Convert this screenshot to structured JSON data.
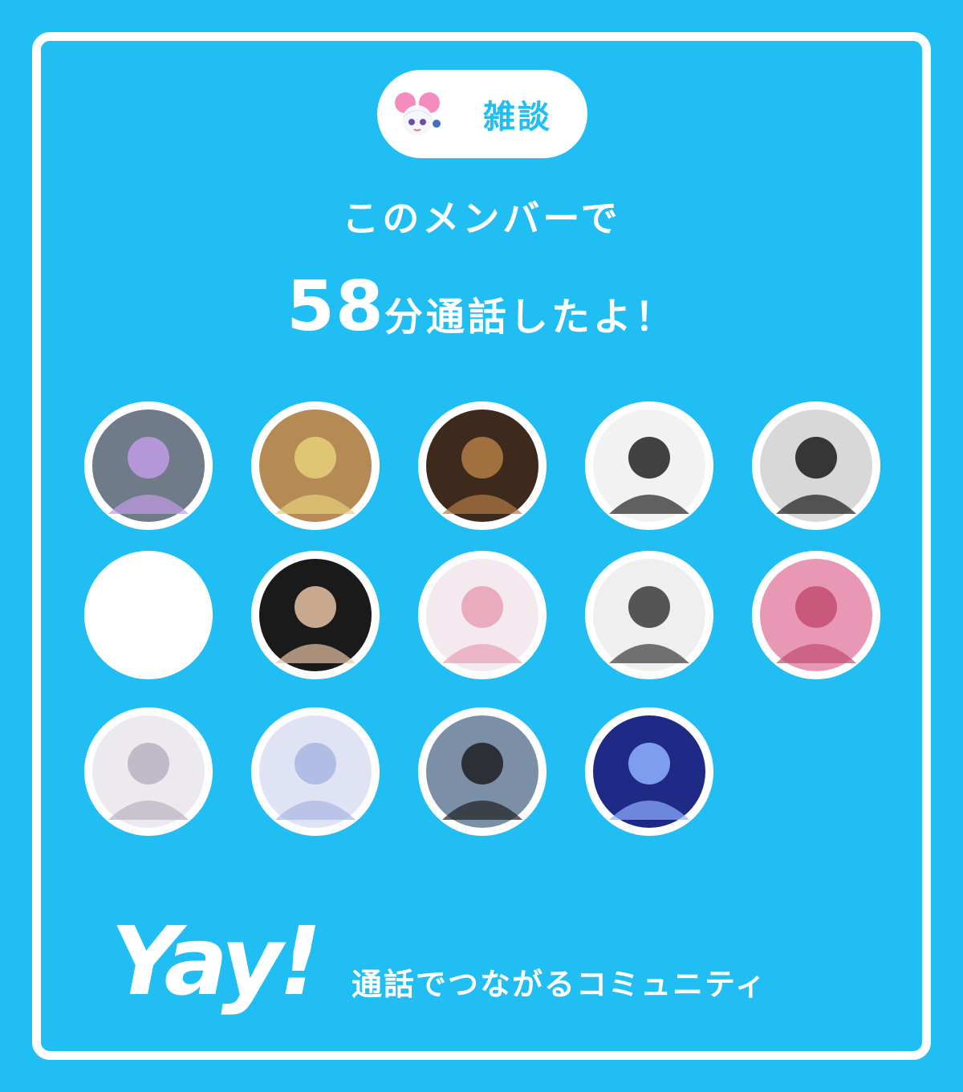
{
  "chip": {
    "label": "雑談",
    "icon": "mascot-icon"
  },
  "headline": {
    "line1": "このメンバーで",
    "minutes": "58",
    "suffix": "分通話したよ！"
  },
  "members": [
    {
      "icon": "rock-character-avatar",
      "tone": "#6f7b88",
      "accent": "#c29be6"
    },
    {
      "icon": "doorway-figures-avatar",
      "tone": "#b68a54",
      "accent": "#e6d07a"
    },
    {
      "icon": "dog-avatar",
      "tone": "#3e2a1c",
      "accent": "#b47b44"
    },
    {
      "icon": "manga-swordsman-avatar",
      "tone": "#f2f2f2",
      "accent": "#222222"
    },
    {
      "icon": "manga-girl-bw-avatar",
      "tone": "#d8d8d8",
      "accent": "#1a1a1a"
    },
    {
      "icon": "blank-avatar",
      "tone": "#ffffff",
      "accent": "#ffffff"
    },
    {
      "icon": "dark-hair-boy-avatar",
      "tone": "#1a1a1a",
      "accent": "#e8c3a4"
    },
    {
      "icon": "pink-hair-girl-avatar",
      "tone": "#f3e9ee",
      "accent": "#e7a0b5"
    },
    {
      "icon": "manga-boy-sketch-avatar",
      "tone": "#efefef",
      "accent": "#3a3a3a"
    },
    {
      "icon": "pink-tint-girl-avatar",
      "tone": "#e898b4",
      "accent": "#c24d73"
    },
    {
      "icon": "white-hair-anime-avatar",
      "tone": "#ece9ef",
      "accent": "#b9b3c2"
    },
    {
      "icon": "pastel-anime-girl-avatar",
      "tone": "#dfe3f4",
      "accent": "#a8b7e3"
    },
    {
      "icon": "smiling-man-avatar",
      "tone": "#7b8fa6",
      "accent": "#1f1f22"
    },
    {
      "icon": "blue-anime-boy-avatar",
      "tone": "#1e2a86",
      "accent": "#8fb1ff"
    }
  ],
  "footer": {
    "logo": "Yay!",
    "tagline": "通話でつながるコミュニティ"
  },
  "colors": {
    "brand": "#20bef2",
    "white": "#ffffff"
  }
}
